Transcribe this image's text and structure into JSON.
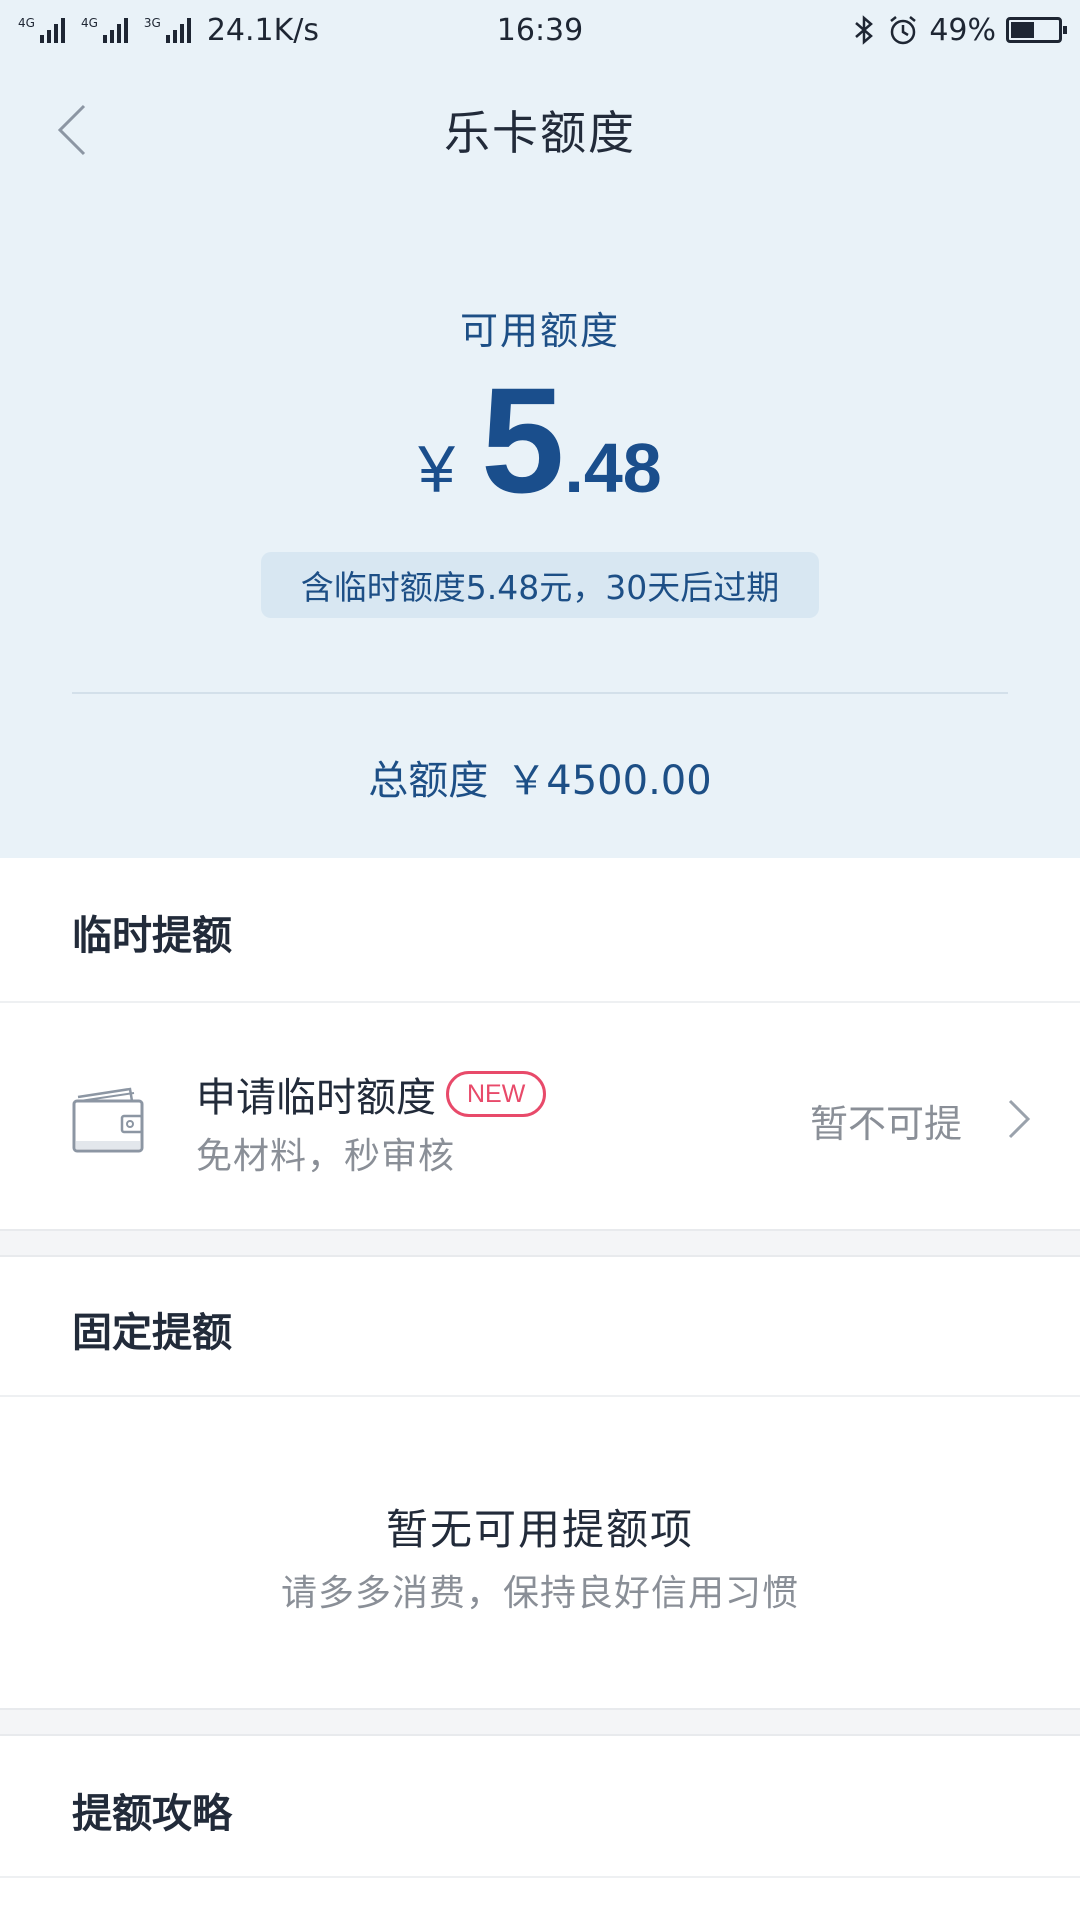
{
  "status_bar": {
    "network_tags": [
      "4G",
      "4G",
      "3G"
    ],
    "speed": "24.1K/s",
    "time": "16:39",
    "battery_percent": "49%",
    "battery_level": 0.49,
    "icons": [
      "bluetooth-icon",
      "alarm-icon",
      "battery-icon"
    ]
  },
  "nav": {
    "title": "乐卡额度",
    "back_icon": "chevron-left-icon"
  },
  "credit": {
    "available_label": "可用额度",
    "currency_symbol": "¥",
    "amount_integer": "5",
    "amount_decimal": ".48",
    "temp_note": "含临时额度5.48元，30天后过期",
    "total_label": "总额度",
    "total_value": "￥4500.00"
  },
  "temp_section": {
    "title": "临时提额",
    "item": {
      "icon": "wallet-icon",
      "title": "申请临时额度",
      "badge": "NEW",
      "subtitle": "免材料，秒审核",
      "status": "暂不可提",
      "chevron": "chevron-right-icon"
    }
  },
  "fixed_section": {
    "title": "固定提额",
    "empty_title": "暂无可用提额项",
    "empty_subtitle": "请多多消费，保持良好信用习惯"
  },
  "strategy_section": {
    "title": "提额攻略"
  },
  "colors": {
    "header_bg": "#e9f2f8",
    "primary_blue": "#1a4e8c",
    "badge_red": "#e84a6a",
    "muted_text": "#8a8f97"
  }
}
